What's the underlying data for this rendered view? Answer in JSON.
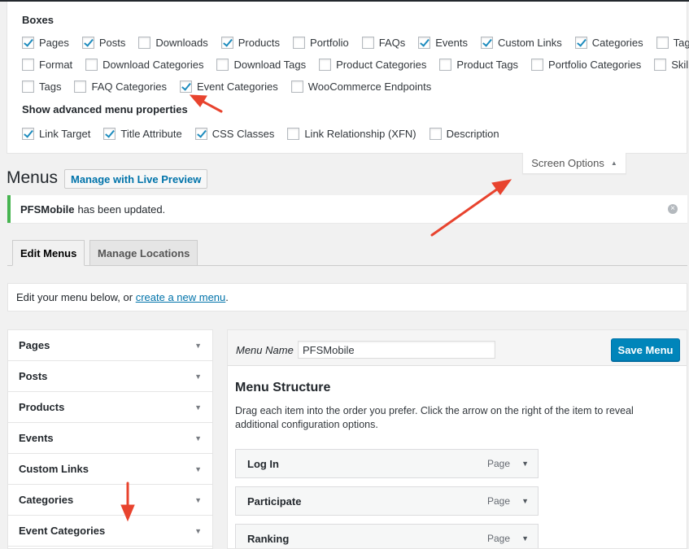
{
  "screen_options": {
    "boxes_heading": "Boxes",
    "boxes": [
      {
        "label": "Pages",
        "checked": true
      },
      {
        "label": "Posts",
        "checked": true
      },
      {
        "label": "Downloads",
        "checked": false
      },
      {
        "label": "Products",
        "checked": true
      },
      {
        "label": "Portfolio",
        "checked": false
      },
      {
        "label": "FAQs",
        "checked": false
      },
      {
        "label": "Events",
        "checked": true
      },
      {
        "label": "Custom Links",
        "checked": true
      },
      {
        "label": "Categories",
        "checked": true
      },
      {
        "label": "Tags",
        "checked": false
      },
      {
        "label": "Format",
        "checked": false
      },
      {
        "label": "Download Categories",
        "checked": false
      },
      {
        "label": "Download Tags",
        "checked": false
      },
      {
        "label": "Product Categories",
        "checked": false
      },
      {
        "label": "Product Tags",
        "checked": false
      },
      {
        "label": "Portfolio Categories",
        "checked": false
      },
      {
        "label": "Skills",
        "checked": false
      },
      {
        "label": "Tags",
        "checked": false
      },
      {
        "label": "FAQ Categories",
        "checked": false
      },
      {
        "label": "Event Categories",
        "checked": true
      },
      {
        "label": "WooCommerce Endpoints",
        "checked": false
      }
    ],
    "advanced_heading": "Show advanced menu properties",
    "advanced": [
      {
        "label": "Link Target",
        "checked": true
      },
      {
        "label": "Title Attribute",
        "checked": true
      },
      {
        "label": "CSS Classes",
        "checked": true
      },
      {
        "label": "Link Relationship (XFN)",
        "checked": false
      },
      {
        "label": "Description",
        "checked": false
      }
    ],
    "tab_label": "Screen Options"
  },
  "header": {
    "title": "Menus",
    "live_preview_button": "Manage with Live Preview"
  },
  "notice": {
    "menu_name": "PFSMobile",
    "message": "has been updated."
  },
  "tabs": [
    {
      "label": "Edit Menus",
      "active": true
    },
    {
      "label": "Manage Locations",
      "active": false
    }
  ],
  "manage": {
    "text_before": "Edit your menu below, or",
    "link_text": "create a new menu",
    "text_after": "."
  },
  "accordion": [
    "Pages",
    "Posts",
    "Products",
    "Events",
    "Custom Links",
    "Categories",
    "Event Categories"
  ],
  "menu_editor": {
    "name_label": "Menu Name",
    "name_value": "PFSMobile",
    "save_button": "Save Menu",
    "structure_title": "Menu Structure",
    "structure_desc": "Drag each item into the order you prefer. Click the arrow on the right of the item to reveal additional configuration options.",
    "items": [
      {
        "title": "Log In",
        "type": "Page"
      },
      {
        "title": "Participate",
        "type": "Page"
      },
      {
        "title": "Ranking",
        "type": "Page"
      }
    ]
  },
  "colors": {
    "accent": "#0085ba",
    "link": "#0073aa",
    "notice_success": "#46b450",
    "annotation_arrow": "#e8432e"
  }
}
